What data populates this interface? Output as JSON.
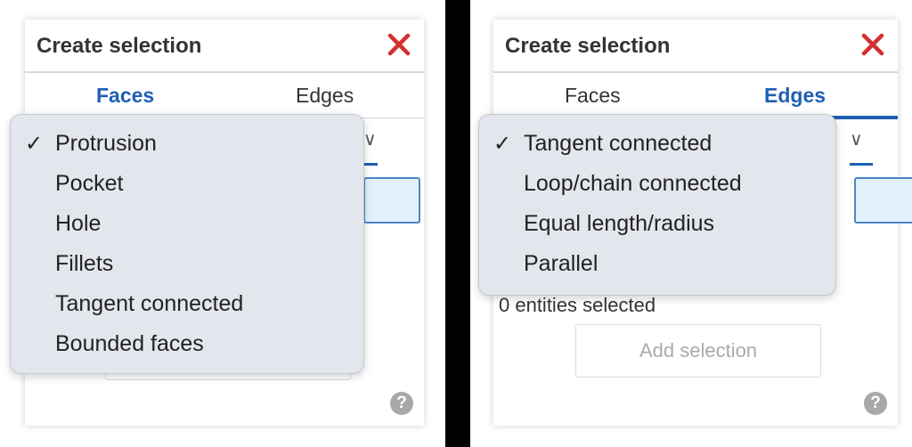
{
  "left_panel": {
    "dialog": {
      "title": "Create selection",
      "tabs": [
        {
          "label": "Faces",
          "active": true
        },
        {
          "label": "Edges",
          "active": false
        }
      ]
    },
    "menu": {
      "checkmark": "✓",
      "selected_index": 0,
      "items": [
        "Protrusion",
        "Pocket",
        "Hole",
        "Fillets",
        "Tangent connected",
        "Bounded faces"
      ]
    },
    "help_symbol": "?"
  },
  "right_panel": {
    "dialog": {
      "title": "Create selection",
      "tabs": [
        {
          "label": "Faces",
          "active": false
        },
        {
          "label": "Edges",
          "active": true
        }
      ],
      "status_text": "0 entities selected",
      "add_selection_label": "Add selection"
    },
    "menu": {
      "checkmark": "✓",
      "selected_index": 0,
      "items": [
        "Tangent connected",
        "Loop/chain connected",
        "Equal length/radius",
        "Parallel"
      ]
    },
    "help_symbol": "?"
  },
  "colors": {
    "accent_blue": "#1f5fb3",
    "close_red": "#d32f2f",
    "menu_background": "#e3e6ec",
    "help_grey": "#a8a8a8"
  }
}
